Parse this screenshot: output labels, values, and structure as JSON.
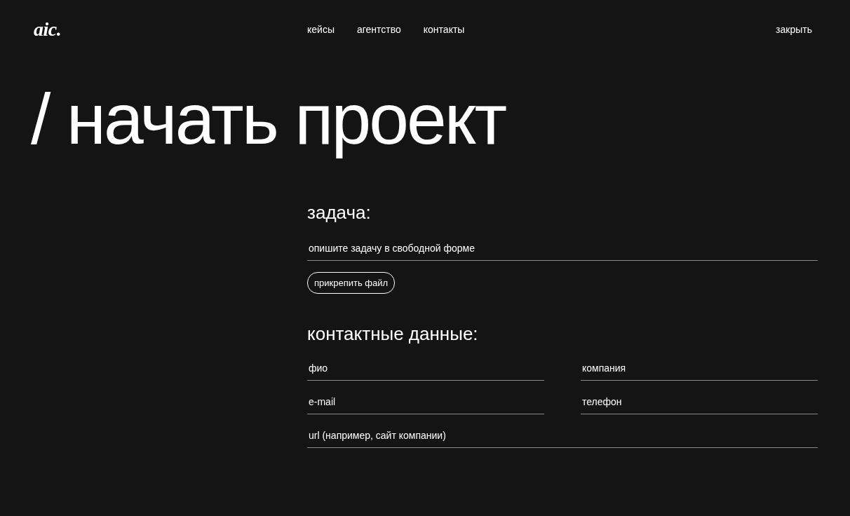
{
  "header": {
    "logo": "aic.",
    "nav": [
      {
        "label": "кейсы"
      },
      {
        "label": "агентство"
      },
      {
        "label": "контакты"
      }
    ],
    "close": "закрыть"
  },
  "title": "/ начать проект",
  "task": {
    "heading": "задача:",
    "field": {
      "placeholder": "опишите задачу в свободной форме"
    },
    "attach": "прикрепить файл"
  },
  "contacts": {
    "heading": "контактные данные:",
    "fields": [
      {
        "placeholder": "фио",
        "kind": "half"
      },
      {
        "placeholder": "компания",
        "kind": "half"
      },
      {
        "placeholder": "e-mail",
        "kind": "half"
      },
      {
        "placeholder": "телефон",
        "kind": "half"
      },
      {
        "placeholder": "url (например, сайт компании)",
        "kind": "full"
      }
    ]
  }
}
